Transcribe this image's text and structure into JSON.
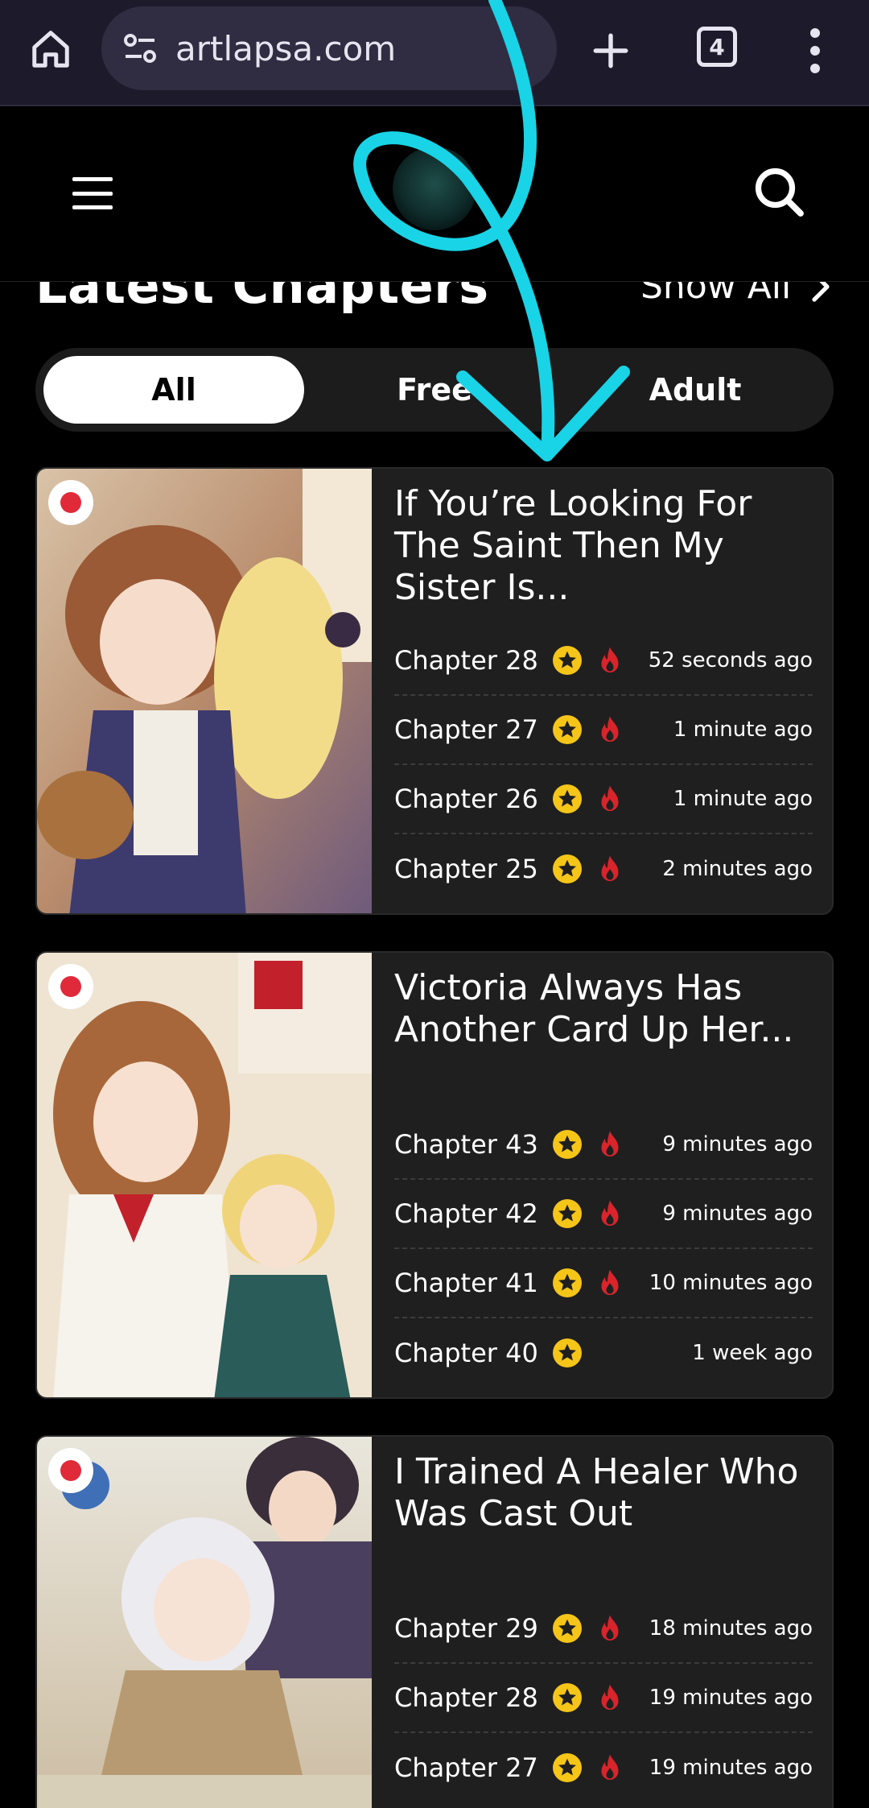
{
  "browser": {
    "url": "artlapsa.com",
    "tab_count": "4",
    "icons": [
      "home-icon",
      "site-settings-icon",
      "plus-icon",
      "tab-switcher-icon",
      "more-vert-icon"
    ]
  },
  "header": {
    "icons": [
      "hamburger-icon",
      "logo",
      "search-icon"
    ]
  },
  "section": {
    "title": "Latest Chapters",
    "show_all": "Show All"
  },
  "filters": [
    "All",
    "Free",
    "Adult"
  ],
  "active_filter": "All",
  "cards": [
    {
      "title": "If You’re Looking For The Saint Then My Sister Is...",
      "chapters": [
        {
          "label": "Chapter 28",
          "time": "52 seconds ago",
          "hot": true
        },
        {
          "label": "Chapter 27",
          "time": "1 minute ago",
          "hot": true
        },
        {
          "label": "Chapter 26",
          "time": "1 minute ago",
          "hot": true
        },
        {
          "label": "Chapter 25",
          "time": "2 minutes ago",
          "hot": true
        }
      ]
    },
    {
      "title": "Victoria Always Has Another Card Up Her...",
      "chapters": [
        {
          "label": "Chapter 43",
          "time": "9 minutes ago",
          "hot": true
        },
        {
          "label": "Chapter 42",
          "time": "9 minutes ago",
          "hot": true
        },
        {
          "label": "Chapter 41",
          "time": "10 minutes ago",
          "hot": true
        },
        {
          "label": "Chapter 40",
          "time": "1 week ago",
          "hot": false
        }
      ]
    },
    {
      "title": "I Trained A Healer Who Was Cast Out",
      "chapters": [
        {
          "label": "Chapter 29",
          "time": "18 minutes ago",
          "hot": true
        },
        {
          "label": "Chapter 28",
          "time": "19 minutes ago",
          "hot": true
        },
        {
          "label": "Chapter 27",
          "time": "19 minutes ago",
          "hot": true
        }
      ]
    }
  ],
  "colors": {
    "browser_bar": "#1d1b2b",
    "url_pill": "#302d42",
    "card_bg": "#1f1f1f",
    "star": "#f5c518",
    "fire": "#d8242b",
    "annotation": "#19d3e6"
  }
}
